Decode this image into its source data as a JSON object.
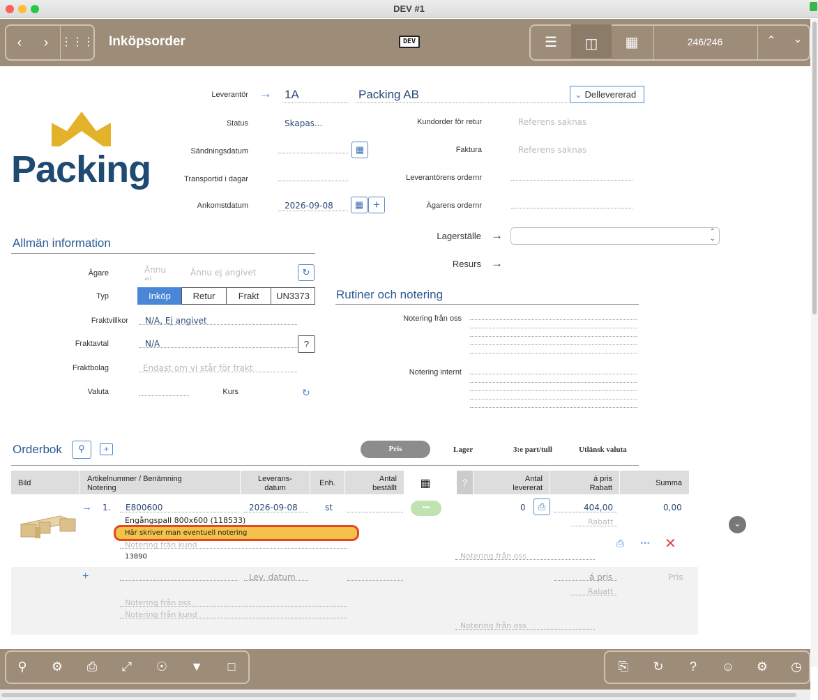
{
  "window": {
    "title": "DEV #1"
  },
  "toolbar": {
    "title": "Inköpsorder",
    "dev_badge": "DEV",
    "record_counter": "246/246"
  },
  "header": {
    "supplier_label": "Leverantör",
    "supplier_code": "1A",
    "supplier_name": "Packing AB",
    "delivery_status": "Dellevererad",
    "status_label": "Status",
    "status_value": "Skapas...",
    "customer_order_label": "Kundorder för retur",
    "customer_order_placeholder": "Referens saknas",
    "send_date_label": "Sändningsdatum",
    "invoice_label": "Faktura",
    "invoice_placeholder": "Referens saknas",
    "transport_label": "Transportid i dagar",
    "supplier_ordernr_label": "Leverantörens ordernr",
    "arrival_label": "Ankomstdatum",
    "arrival_value": "2026-09-08",
    "owner_ordernr_label": "Ägarens ordernr"
  },
  "logo": {
    "text": "Packing",
    "crown_color": "#e3b22a",
    "text_color": "#1f4a72"
  },
  "general": {
    "title": "Allmän information",
    "owner_label": "Ägare",
    "owner_code_placeholder": "Ännu ej",
    "owner_placeholder": "Ännu ej angivet",
    "type_label": "Typ",
    "type_options": [
      "Inköp",
      "Retur",
      "Frakt",
      "UN3373"
    ],
    "type_selected": "Inköp",
    "freight_terms_label": "Fraktvillkor",
    "freight_terms_value": "N/A, Ej angivet",
    "freight_agreement_label": "Fraktavtal",
    "freight_agreement_value": "N/A",
    "carrier_label": "Fraktbolag",
    "carrier_placeholder": "Endast om vi står för frakt",
    "currency_label": "Valuta",
    "rate_label": "Kurs"
  },
  "warehouse": {
    "label": "Lagerställe",
    "resource_label": "Resurs"
  },
  "routines": {
    "title": "Rutiner och notering",
    "note_from_us_label": "Notering från oss",
    "note_internal_label": "Notering internt"
  },
  "orderbook": {
    "title": "Orderbok",
    "tabs": [
      "Pris",
      "Lager",
      "3:e part/tull",
      "Utlänsk valuta"
    ],
    "active_tab": "Pris",
    "columns": {
      "image": "Bild",
      "article": "Artikelnummer / Benämning",
      "note": "Notering",
      "delivery_date_1": "Leverans-",
      "delivery_date_2": "datum",
      "unit": "Enh.",
      "ordered_1": "Antal",
      "ordered_2": "beställt",
      "delivered_1": "Antal",
      "delivered_2": "levererat",
      "price_1": "á pris",
      "price_2": "Rabatt",
      "sum": "Summa",
      "question": "?"
    },
    "row": {
      "index": "1.",
      "article_no": "E800600",
      "delivery_date": "2026-09-08",
      "unit": "st",
      "name": "Engångspall 800x600 (118533)",
      "highlight_note": "Här skriver man eventuell notering",
      "note_customer_placeholder": "Notering från kund",
      "extra": "13890",
      "delivered": "0",
      "price": "404,00",
      "discount_placeholder": "Rabatt",
      "sum": "0,00",
      "note_from_us_placeholder": "Notering från oss",
      "more": "•••"
    },
    "new_row": {
      "delivery_date_placeholder": "Lev. datum",
      "price_placeholder": "á pris",
      "price_col_placeholder": "Pris",
      "discount_placeholder": "Rabatt",
      "note_from_us_placeholder": "Notering från oss",
      "note_customer_placeholder": "Notering från kund",
      "note_from_us_right_placeholder": "Notering från oss"
    }
  },
  "colors": {
    "toolbar": "#9d8c78",
    "accent": "#4a86d6",
    "highlight": "#f3c24a",
    "highlight_border": "#e8461e",
    "tab_active": "#8c8c8c"
  }
}
